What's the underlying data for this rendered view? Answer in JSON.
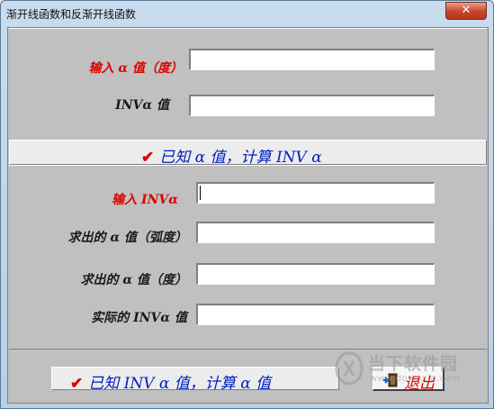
{
  "window": {
    "title": "渐开线函数和反渐开线函数",
    "close_glyph": "✕"
  },
  "forward": {
    "alpha_deg_label": "输入 α 值（度）",
    "alpha_deg_value": "",
    "inv_label": "INVα 值",
    "inv_value": "",
    "compute_button": "已知  α  值，计算  INV α"
  },
  "inverse": {
    "inv_input_label": "输入 INVα",
    "inv_input_value": "",
    "alpha_rad_label": "求出的 α 值（弧度）",
    "alpha_rad_value": "",
    "alpha_deg_label": "求出的 α 值（度）",
    "alpha_deg_value": "",
    "actual_inv_label": "实际的 INVα 值",
    "actual_inv_value": "",
    "compute_button": "已知  INV α  值，计算  α  值"
  },
  "footer": {
    "exit_button": "退出",
    "check_glyph": "✔"
  },
  "watermark": {
    "text": "当下软件园",
    "url": "www.downxia.com"
  },
  "icons": {
    "check": "check-icon",
    "exit": "door-exit-icon",
    "close": "close-icon"
  },
  "colors": {
    "label_red": "#e00000",
    "button_text_blue": "#0020c0",
    "panel_gray": "#c0c0c0"
  }
}
